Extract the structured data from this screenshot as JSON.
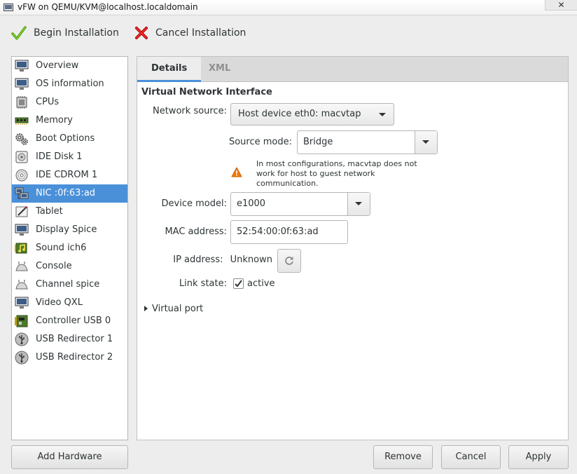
{
  "window": {
    "title": "vFW on QEMU/KVM@localhost.localdomain",
    "close_glyph": "✕"
  },
  "toolbar": {
    "begin_label": "Begin Installation",
    "cancel_label": "Cancel Installation"
  },
  "sidebar": {
    "items": [
      {
        "label": "Overview",
        "icon": "monitor-icon"
      },
      {
        "label": "OS information",
        "icon": "monitor-icon"
      },
      {
        "label": "CPUs",
        "icon": "cpu-icon"
      },
      {
        "label": "Memory",
        "icon": "memory-icon"
      },
      {
        "label": "Boot Options",
        "icon": "gears-icon"
      },
      {
        "label": "IDE Disk 1",
        "icon": "disk-icon"
      },
      {
        "label": "IDE CDROM 1",
        "icon": "cdrom-icon"
      },
      {
        "label": "NIC :0f:63:ad",
        "icon": "network-icon",
        "selected": true
      },
      {
        "label": "Tablet",
        "icon": "tablet-icon"
      },
      {
        "label": "Display Spice",
        "icon": "display-icon"
      },
      {
        "label": "Sound ich6",
        "icon": "sound-icon"
      },
      {
        "label": "Console",
        "icon": "console-icon"
      },
      {
        "label": "Channel spice",
        "icon": "channel-icon"
      },
      {
        "label": "Video QXL",
        "icon": "video-icon"
      },
      {
        "label": "Controller USB 0",
        "icon": "controller-icon"
      },
      {
        "label": "USB Redirector 1",
        "icon": "usb-icon"
      },
      {
        "label": "USB Redirector 2",
        "icon": "usb-icon"
      }
    ]
  },
  "tabs": {
    "details": "Details",
    "xml": "XML"
  },
  "nic": {
    "section_title": "Virtual Network Interface",
    "network_source_label": "Network source:",
    "network_source_value": "Host device eth0: macvtap",
    "source_mode_label": "Source mode:",
    "source_mode_value": "Bridge",
    "warning": "In most configurations, macvtap does not work for host to guest network communication.",
    "device_model_label": "Device model:",
    "device_model_value": "e1000",
    "mac_label": "MAC address:",
    "mac_value": "52:54:00:0f:63:ad",
    "ip_label": "IP address:",
    "ip_value": "Unknown",
    "link_label": "Link state:",
    "link_value": "active",
    "link_checked": true,
    "virtual_port_label": "Virtual port"
  },
  "buttons": {
    "add_hardware": "Add Hardware",
    "remove": "Remove",
    "cancel": "Cancel",
    "apply": "Apply"
  },
  "colors": {
    "selection": "#4a90d9",
    "accept_check": "#4e9a06",
    "cancel_x": "#cc0000",
    "warning": "#f57900"
  }
}
